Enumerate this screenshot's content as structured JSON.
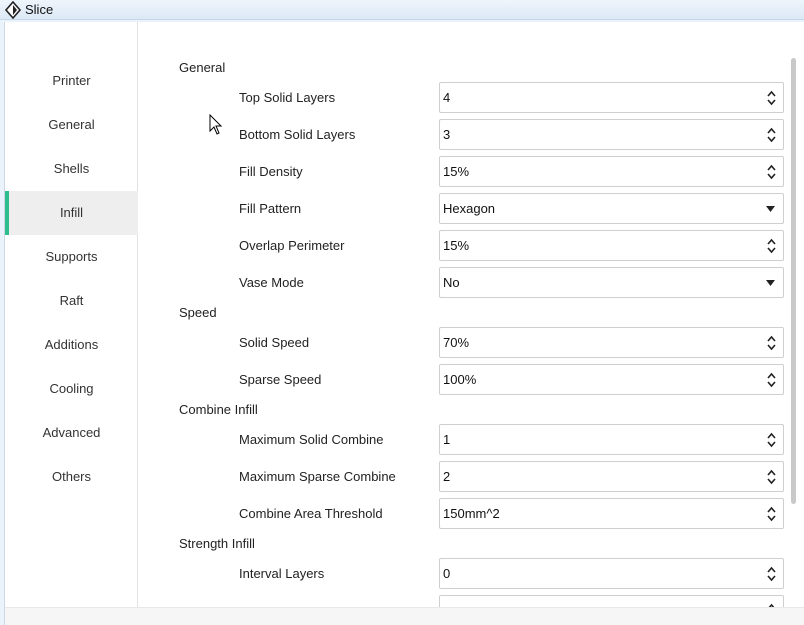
{
  "window": {
    "title": "Slice"
  },
  "sidebar": {
    "items": [
      {
        "label": "Printer",
        "active": false
      },
      {
        "label": "General",
        "active": false
      },
      {
        "label": "Shells",
        "active": false
      },
      {
        "label": "Infill",
        "active": true
      },
      {
        "label": "Supports",
        "active": false
      },
      {
        "label": "Raft",
        "active": false
      },
      {
        "label": "Additions",
        "active": false
      },
      {
        "label": "Cooling",
        "active": false
      },
      {
        "label": "Advanced",
        "active": false
      },
      {
        "label": "Others",
        "active": false
      }
    ]
  },
  "sections": [
    {
      "title": "General",
      "fields": [
        {
          "label": "Top Solid Layers",
          "value": "4",
          "control": "spinbox"
        },
        {
          "label": "Bottom Solid Layers",
          "value": "3",
          "control": "spinbox"
        },
        {
          "label": "Fill Density",
          "value": "15%",
          "control": "spinbox"
        },
        {
          "label": "Fill Pattern",
          "value": "Hexagon",
          "control": "dropdown"
        },
        {
          "label": "Overlap Perimeter",
          "value": "15%",
          "control": "spinbox"
        },
        {
          "label": "Vase Mode",
          "value": "No",
          "control": "dropdown"
        }
      ]
    },
    {
      "title": "Speed",
      "fields": [
        {
          "label": "Solid Speed",
          "value": "70%",
          "control": "spinbox"
        },
        {
          "label": "Sparse Speed",
          "value": "100%",
          "control": "spinbox"
        }
      ]
    },
    {
      "title": "Combine Infill",
      "fields": [
        {
          "label": "Maximum Solid Combine",
          "value": "1",
          "control": "spinbox"
        },
        {
          "label": "Maximum Sparse Combine",
          "value": "2",
          "control": "spinbox"
        },
        {
          "label": "Combine Area Threshold",
          "value": "150mm^2",
          "control": "spinbox"
        }
      ]
    },
    {
      "title": "Strength Infill",
      "fields": [
        {
          "label": "Interval Layers",
          "value": "0",
          "control": "spinbox"
        },
        {
          "label": "",
          "value": "",
          "control": "spinbox"
        }
      ]
    }
  ],
  "colors": {
    "accent": "#2dbd8f",
    "active_bg": "#eeeeef",
    "border": "#cfcfcf"
  }
}
